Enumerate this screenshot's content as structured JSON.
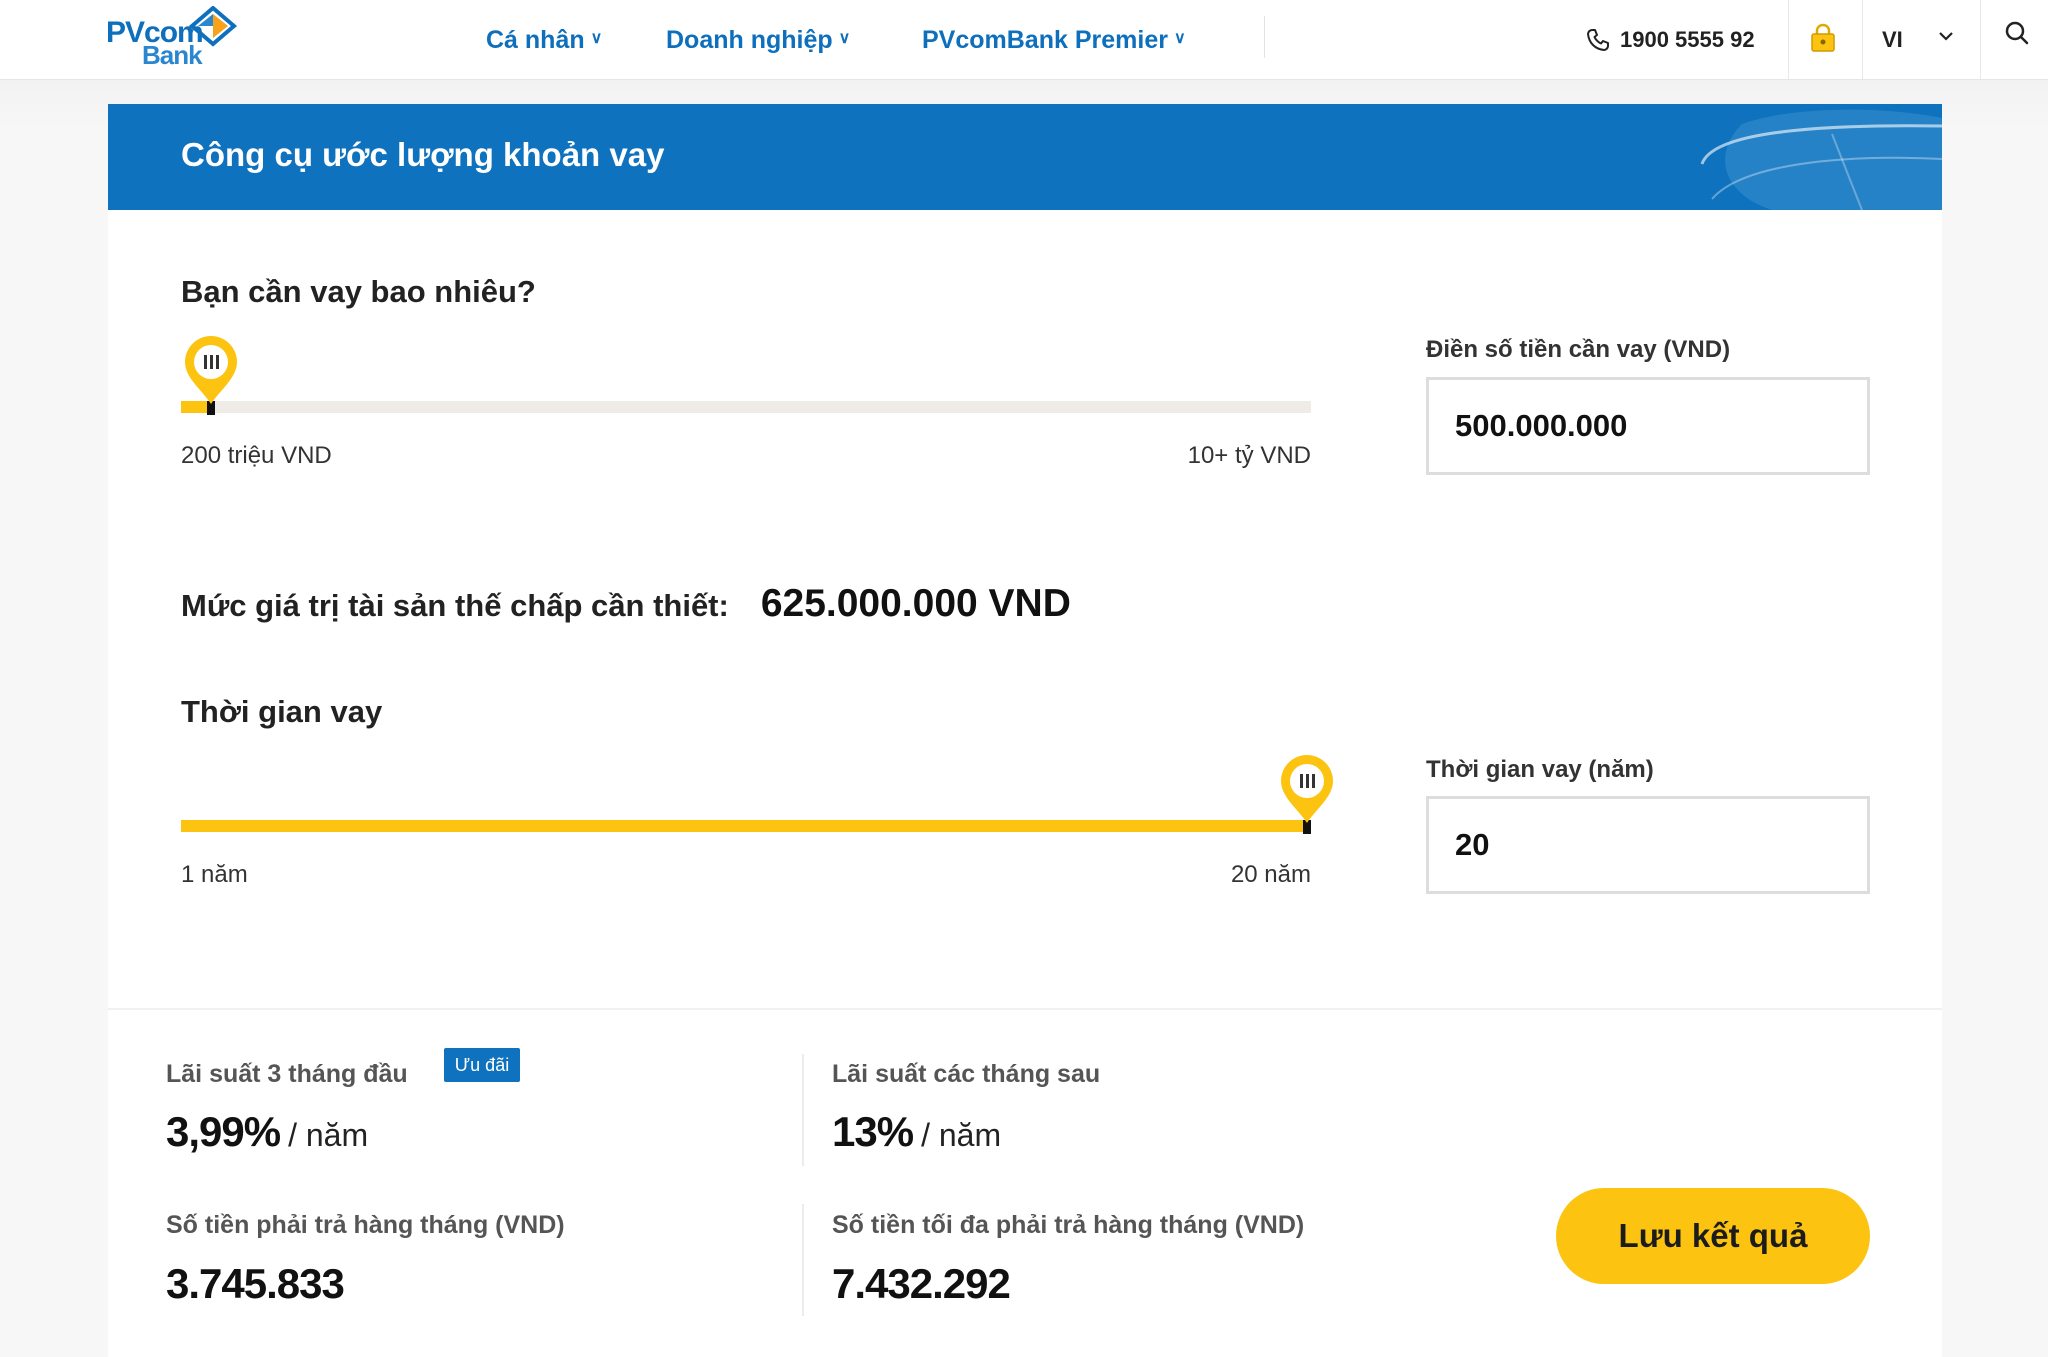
{
  "brand": {
    "logo_line1": "PVcom",
    "logo_line2": "Bank"
  },
  "nav": {
    "items": [
      {
        "label": "Cá nhân"
      },
      {
        "label": "Doanh nghiệp"
      },
      {
        "label": "PVcomBank Premier"
      }
    ],
    "phone": "1900 5555 92",
    "language": "VI"
  },
  "calculator": {
    "title": "Công cụ ước lượng khoản vay",
    "amount": {
      "question": "Bạn cần vay bao nhiêu?",
      "min_label": "200 triệu VND",
      "max_label": "10+ tỷ VND",
      "field_label": "Điền số tiền cần vay (VND)",
      "value": "500.000.000",
      "slider_fraction": 0.03
    },
    "collateral": {
      "label": "Mức giá trị tài sản thế chấp cần thiết:",
      "value": "625.000.000 VND"
    },
    "term": {
      "question": "Thời gian vay",
      "min_label": "1 năm",
      "max_label": "20 năm",
      "field_label": "Thời gian vay (năm)",
      "value": "20",
      "slider_fraction": 1.0
    }
  },
  "results": {
    "intro_rate_label": "Lãi suất 3 tháng đầu",
    "badge": "Ưu đãi",
    "intro_rate_value": "3,99%",
    "rate_unit": "/ năm",
    "later_rate_label": "Lãi suất các tháng sau",
    "later_rate_value": "13%",
    "monthly_label": "Số tiền phải trả hàng tháng (VND)",
    "monthly_value": "3.745.833",
    "max_monthly_label": "Số tiền tối đa phải trả hàng tháng (VND)",
    "max_monthly_value": "7.432.292",
    "save_button": "Lưu kết quả"
  },
  "colors": {
    "brand_blue": "#0e72be",
    "accent_yellow": "#fcc410",
    "logo_orange": "#f6a21b"
  },
  "icons": [
    "chevron-down-icon",
    "phone-icon",
    "lock-icon",
    "search-icon",
    "slider-handle-icon"
  ]
}
